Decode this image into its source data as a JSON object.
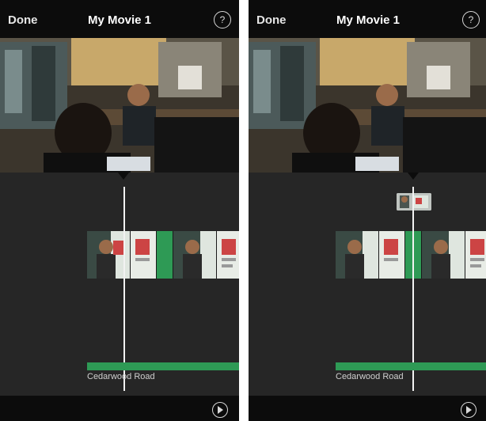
{
  "screens": [
    {
      "nav": {
        "done_label": "Done",
        "title": "My Movie 1",
        "help_icon": "?"
      },
      "audio": {
        "label": "Cedarwood Road",
        "color": "#2e9a55"
      },
      "state": "playhead-over-clip"
    },
    {
      "nav": {
        "done_label": "Done",
        "title": "My Movie 1",
        "help_icon": "?"
      },
      "audio": {
        "label": "Cedarwood Road",
        "color": "#2e9a55"
      },
      "state": "clip-lifted-above-timeline"
    }
  ],
  "icons": {
    "help": "help-circle-icon",
    "share": "share-play-icon"
  },
  "colors": {
    "bar_background": "#0c0c0c",
    "timeline_background": "#262626",
    "accent_green": "#2e9a55"
  }
}
